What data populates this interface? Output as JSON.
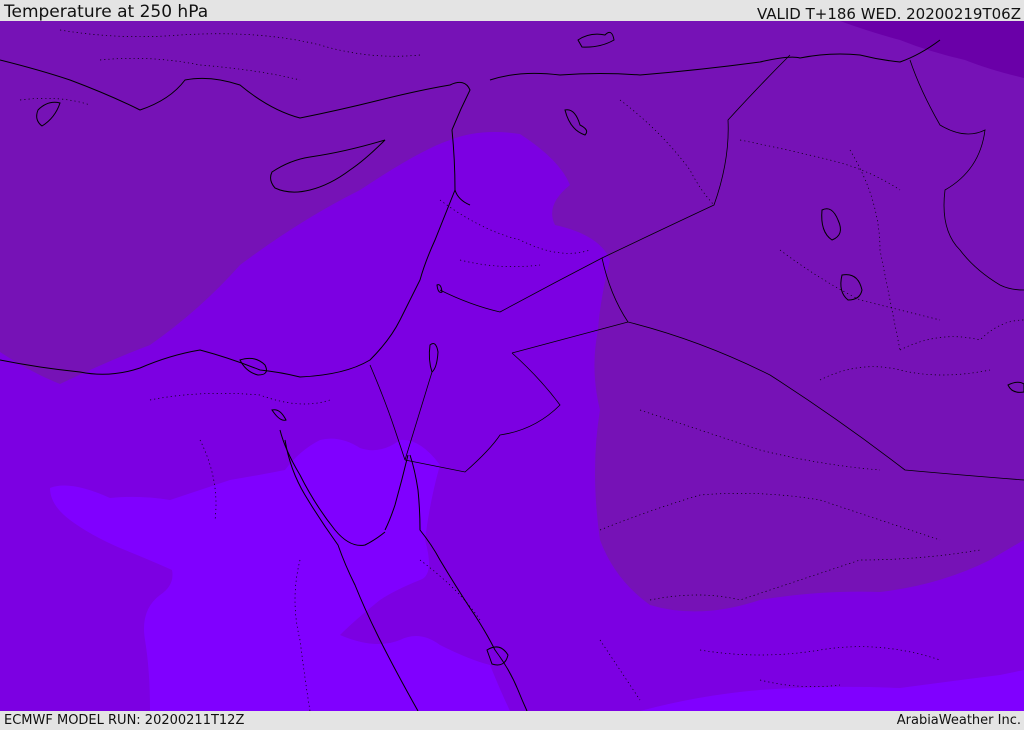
{
  "header": {
    "title": "Temperature at 250 hPa",
    "valid_time": "VALID T+186 WED. 20200219T06Z"
  },
  "footer": {
    "model_run": "ECMWF MODEL RUN: 20200211T12Z",
    "credit": "ArabiaWeather Inc."
  },
  "colors": {
    "coldest_band": "#6a00a8",
    "cold_band": "#7612b6",
    "mid_band": "#7c00e2",
    "warm_band": "#8000ff",
    "outline": "#000000"
  }
}
